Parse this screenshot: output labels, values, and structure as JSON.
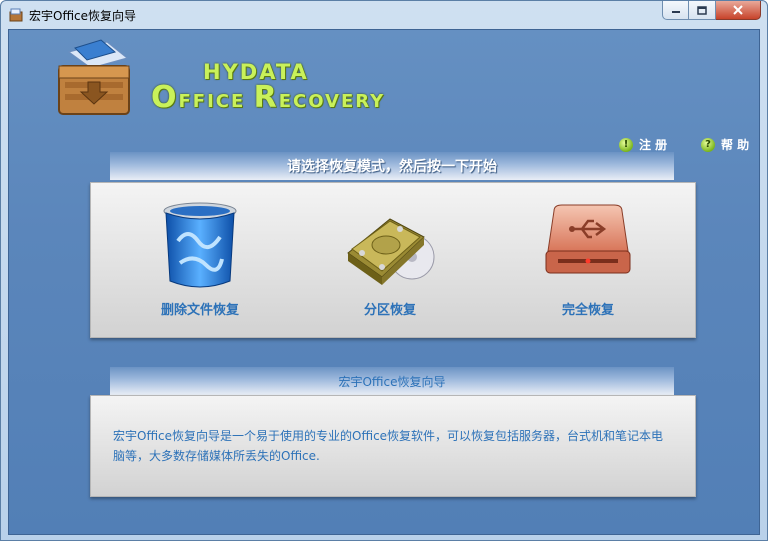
{
  "window": {
    "title": "宏宇Office恢复向导",
    "controls": {
      "minimize": "—",
      "maximize": "□",
      "close": "✕"
    }
  },
  "brand": {
    "top_line": "HYDATA",
    "bottom_first": "O",
    "bottom_rest": "FFICE",
    "bottom_second_initial": "R",
    "bottom_second_rest": "ECOVERY"
  },
  "links": {
    "register": {
      "icon": "!",
      "label": "注 册"
    },
    "help": {
      "icon": "?",
      "label": "帮 助"
    }
  },
  "modes_band": {
    "text": "请选择恢复模式，然后按一下开始"
  },
  "modes": [
    {
      "label": "删除文件恢复",
      "icon": "recycle-bin-icon"
    },
    {
      "label": "分区恢复",
      "icon": "hard-disk-icon"
    },
    {
      "label": "完全恢复",
      "icon": "usb-drive-icon"
    }
  ],
  "info_band": {
    "text": "宏宇Office恢复向导"
  },
  "description": "宏宇Office恢复向导是一个易于使用的专业的Office恢复软件，可以恢复包括服务器，台式机和笔记本电脑等，大多数存储媒体所丢失的Office.",
  "colors": {
    "client_bg": "#5b86bb",
    "link_text": "#2d72b8",
    "brand_green": "#c9f15a"
  }
}
